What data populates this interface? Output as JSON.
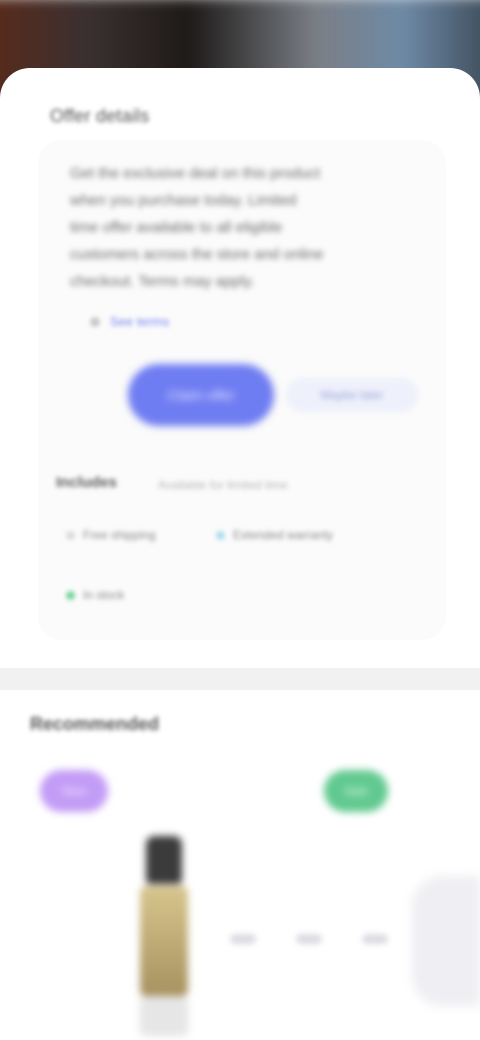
{
  "header": {
    "sheet_title": "Offer details"
  },
  "offer": {
    "description_lines": [
      "Get the exclusive deal on this product",
      "when you purchase today. Limited",
      "time offer available to all eligible",
      "customers across the store and online",
      "checkout. Terms may apply."
    ],
    "link_label": "See terms",
    "primary_button": "Claim offer",
    "secondary_button": "Maybe later"
  },
  "details": {
    "heading": "Includes",
    "subheading": "Available for limited time",
    "tags": [
      {
        "label": "Free shipping",
        "color": "#d9d9d9"
      },
      {
        "label": "Extended warranty",
        "color": "#a9dcef"
      },
      {
        "label": "In stock",
        "color": "#71d39a"
      }
    ]
  },
  "recommendations": {
    "title": "Recommended",
    "pill_left": "New",
    "pill_right": "Sale"
  },
  "colors": {
    "accent": "#6f7df2",
    "purple": "#c39cf6",
    "green": "#61c98f"
  }
}
